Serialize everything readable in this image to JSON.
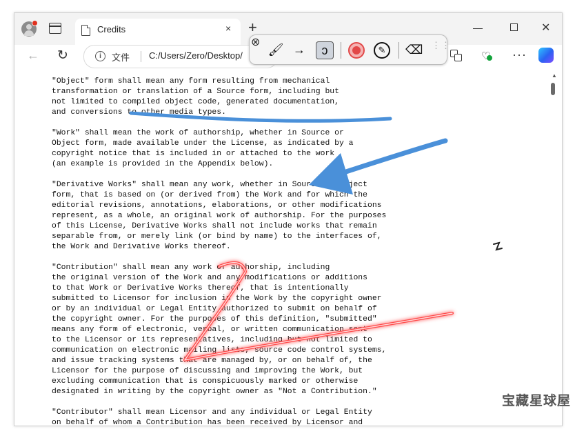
{
  "browser": {
    "tab": {
      "title": "Credits",
      "close": "×"
    },
    "new_tab": "+",
    "window_controls": {
      "minimize": "—",
      "close": "✕"
    },
    "address": {
      "scheme": "文件",
      "url": "C:/Users/Zero/Desktop/"
    },
    "menu": "···",
    "icons": [
      "profile-icon",
      "tabs-icon",
      "page-icon",
      "back-icon",
      "reload-icon",
      "info-icon",
      "extensions-icon",
      "health-icon",
      "copilot-icon"
    ]
  },
  "annotation_toolbar": {
    "close": "⊗",
    "tools": {
      "brush": "🖌",
      "arrow": "→",
      "squiggle": "ↄ",
      "pencil": "✎",
      "eraser": "⌫",
      "handle": "⋮⋮"
    },
    "colors": {
      "red": "#e24848",
      "blue": "#4a90d9"
    }
  },
  "document": {
    "text": "\"Object\" form shall mean any form resulting from mechanical\ntransformation or translation of a Source form, including but\nnot limited to compiled object code, generated documentation,\nand conversions to other media types.\n\n\"Work\" shall mean the work of authorship, whether in Source or\nObject form, made available under the License, as indicated by a\ncopyright notice that is included in or attached to the work\n(an example is provided in the Appendix below).\n\n\"Derivative Works\" shall mean any work, whether in Source or Object\nform, that is based on (or derived from) the Work and for which the\neditorial revisions, annotations, elaborations, or other modifications\nrepresent, as a whole, an original work of authorship. For the purposes\nof this License, Derivative Works shall not include works that remain\nseparable from, or merely link (or bind by name) to the interfaces of,\nthe Work and Derivative Works thereof.\n\n\"Contribution\" shall mean any work of authorship, including\nthe original version of the Work and any modifications or additions\nto that Work or Derivative Works thereof, that is intentionally\nsubmitted to Licensor for inclusion in the Work by the copyright owner\nor by an individual or Legal Entity authorized to submit on behalf of\nthe copyright owner. For the purposes of this definition, \"submitted\"\nmeans any form of electronic, verbal, or written communication sent\nto the Licensor or its representatives, including but not limited to\ncommunication on electronic mailing lists, source code control systems,\nand issue tracking systems that are managed by, or on behalf of, the\nLicensor for the purpose of discussing and improving the Work, but\nexcluding communication that is conspicuously marked or otherwise\ndesignated in writing by the copyright owner as \"Not a Contribution.\"\n\n\"Contributor\" shall mean Licensor and any individual or Legal Entity\non behalf of whom a Contribution has been received by Licensor and"
  },
  "watermark": "宝藏星球屋"
}
